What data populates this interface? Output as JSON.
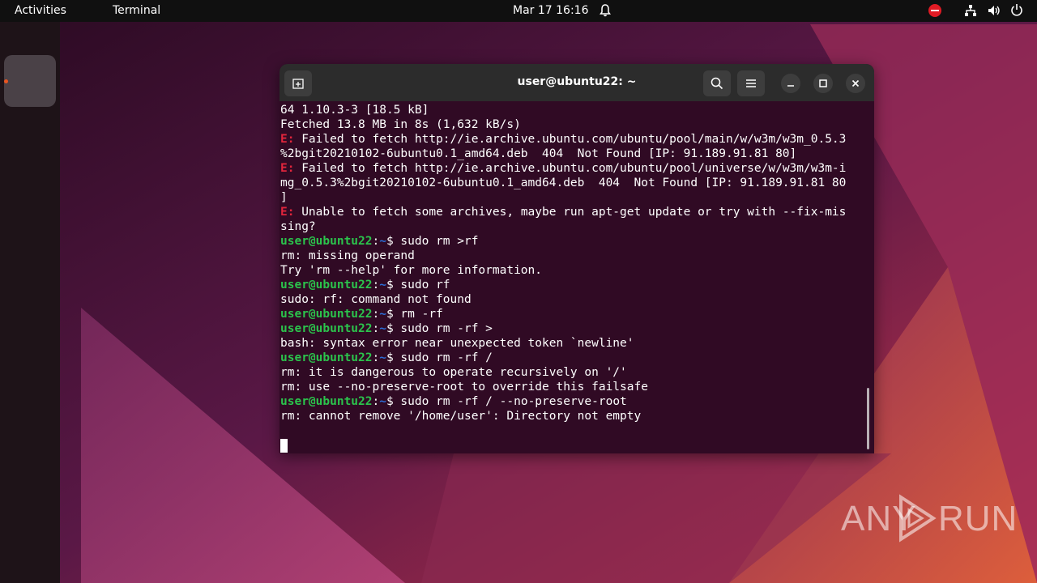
{
  "topbar": {
    "activities": "Activities",
    "app_name": "Terminal",
    "clock": "Mar 17  16:16"
  },
  "window": {
    "title": "user@ubuntu22: ~"
  },
  "terminal": {
    "lines": [
      [
        {
          "t": "64 1.10.3-3 [18.5 kB]",
          "c": ""
        }
      ],
      [
        {
          "t": "Fetched 13.8 MB in 8s (1,632 kB/s)",
          "c": ""
        }
      ],
      [
        {
          "t": "E: ",
          "c": "err"
        },
        {
          "t": "Failed to fetch http://ie.archive.ubuntu.com/ubuntu/pool/main/w/w3m/w3m_0.5.3",
          "c": ""
        }
      ],
      [
        {
          "t": "%2bgit20210102-6ubuntu0.1_amd64.deb  404  Not Found [IP: 91.189.91.81 80]",
          "c": ""
        }
      ],
      [
        {
          "t": "E: ",
          "c": "err"
        },
        {
          "t": "Failed to fetch http://ie.archive.ubuntu.com/ubuntu/pool/universe/w/w3m/w3m-i",
          "c": ""
        }
      ],
      [
        {
          "t": "mg_0.5.3%2bgit20210102-6ubuntu0.1_amd64.deb  404  Not Found [IP: 91.189.91.81 80",
          "c": ""
        }
      ],
      [
        {
          "t": "]",
          "c": ""
        }
      ],
      [
        {
          "t": "E: ",
          "c": "err"
        },
        {
          "t": "Unable to fetch some archives, maybe run apt-get update or try with --fix-mis",
          "c": ""
        }
      ],
      [
        {
          "t": "sing?",
          "c": ""
        }
      ],
      [
        {
          "t": "user@ubuntu22",
          "c": "prompt"
        },
        {
          "t": ":",
          "c": ""
        },
        {
          "t": "~",
          "c": "path"
        },
        {
          "t": "$ sudo rm >rf",
          "c": ""
        }
      ],
      [
        {
          "t": "rm: missing operand",
          "c": ""
        }
      ],
      [
        {
          "t": "Try 'rm --help' for more information.",
          "c": ""
        }
      ],
      [
        {
          "t": "user@ubuntu22",
          "c": "prompt"
        },
        {
          "t": ":",
          "c": ""
        },
        {
          "t": "~",
          "c": "path"
        },
        {
          "t": "$ sudo rf",
          "c": ""
        }
      ],
      [
        {
          "t": "sudo: rf: command not found",
          "c": ""
        }
      ],
      [
        {
          "t": "user@ubuntu22",
          "c": "prompt"
        },
        {
          "t": ":",
          "c": ""
        },
        {
          "t": "~",
          "c": "path"
        },
        {
          "t": "$ rm -rf",
          "c": ""
        }
      ],
      [
        {
          "t": "user@ubuntu22",
          "c": "prompt"
        },
        {
          "t": ":",
          "c": ""
        },
        {
          "t": "~",
          "c": "path"
        },
        {
          "t": "$ sudo rm -rf >",
          "c": ""
        }
      ],
      [
        {
          "t": "bash: syntax error near unexpected token `newline'",
          "c": ""
        }
      ],
      [
        {
          "t": "user@ubuntu22",
          "c": "prompt"
        },
        {
          "t": ":",
          "c": ""
        },
        {
          "t": "~",
          "c": "path"
        },
        {
          "t": "$ sudo rm -rf /",
          "c": ""
        }
      ],
      [
        {
          "t": "rm: it is dangerous to operate recursively on '/'",
          "c": ""
        }
      ],
      [
        {
          "t": "rm: use --no-preserve-root to override this failsafe",
          "c": ""
        }
      ],
      [
        {
          "t": "user@ubuntu22",
          "c": "prompt"
        },
        {
          "t": ":",
          "c": ""
        },
        {
          "t": "~",
          "c": "path"
        },
        {
          "t": "$ sudo rm -rf / --no-preserve-root",
          "c": ""
        }
      ],
      [
        {
          "t": "rm: cannot remove '/home/user': Directory not empty",
          "c": ""
        }
      ]
    ]
  },
  "watermark": {
    "left": "ANY",
    "right": "RUN"
  },
  "colors": {
    "terminal_bg": "#300a24",
    "prompt": "#2bc44c",
    "error": "#e0253c",
    "accent": "#e95420"
  }
}
